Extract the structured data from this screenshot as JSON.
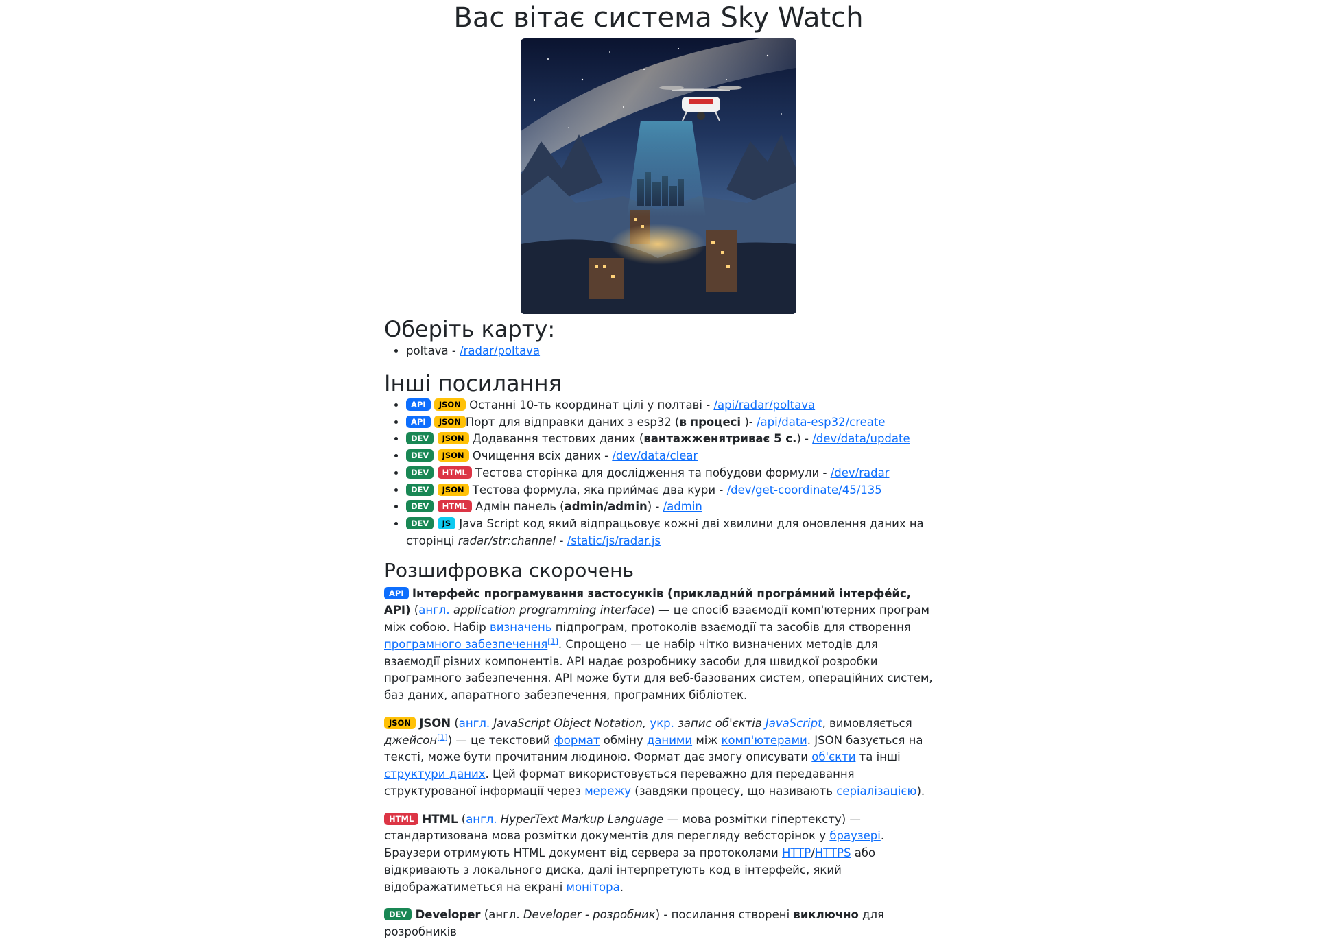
{
  "page": {
    "title": "Вас вітає система Sky Watch"
  },
  "hero": {
    "alt": "Sky Watch drone over night city"
  },
  "maps": {
    "heading": "Оберіть карту:",
    "items": [
      {
        "name": "poltava",
        "sep": " - ",
        "link": "/radar/poltava"
      }
    ]
  },
  "links": {
    "heading": "Інші посилання",
    "items": [
      {
        "text": " Останні 10-ть координат цілі у полтаві - ",
        "link": "/api/radar/poltava"
      },
      {
        "text_a": "Порт для відправки даних з esp32 (",
        "bold": "в процесі",
        "text_b": " )- ",
        "link": "/api/data-esp32/create"
      },
      {
        "text_a": " Додавання тестових даних (",
        "bold": "вантажженятриває 5 с.",
        "text_b": ") - ",
        "link": "/dev/data/update"
      },
      {
        "text": " Очищення всіх даних - ",
        "link": "/dev/data/clear"
      },
      {
        "text": " Тестова сторінка для дослідження та побудови формули - ",
        "link": "/dev/radar"
      },
      {
        "text": " Тестова формула, яка приймає два кури - ",
        "link": "/dev/get-coordinate/45/135"
      },
      {
        "text_a": " Адмін панель (",
        "bold": "admin/admin",
        "text_b": ") - ",
        "link": "/admin"
      },
      {
        "text": " Java Script код який відпрацьовує кожні дві хвилини для оновлення даних на сторінці ",
        "italic": "radar/str:channel",
        "text_b": " - ",
        "link": "/static/js/radar.js"
      }
    ]
  },
  "badges": {
    "api": "API",
    "json": "JSON",
    "dev": "DEV",
    "html": "HTML",
    "js": "JS"
  },
  "glossary": {
    "heading": "Розшифровка скорочень",
    "api": {
      "bold": "Інтерфейс програмування застосунків (прикладни́й програ́мний інтерфе́йс, API)",
      "p1": " (",
      "l_angl": "англ.",
      "i1": " application programming interface",
      "p2": ") — це спосіб взаємодії комп'ютерних програм між собою. Набір ",
      "l_vyzn": "визначень",
      "p3": " підпрограм, протоколів взаємодії та засобів для створення ",
      "l_pz": "програмного забезпечення",
      "ref": "[1]",
      "p4": ". Спрощено — це набір чітко визначених методів для взаємодії різних компонентів. API надає розробнику засоби для швидкої розробки програмного забезпечення. API може бути для веб-базованих систем, операційних систем, баз даних, апаратного забезпечення, програмних бібліотек."
    },
    "json": {
      "bold": "JSON",
      "p1": " (",
      "l_angl": "англ.",
      "i1": " JavaScript Object Notation,",
      "p2": " ",
      "l_ukr": "укр.",
      "i2": " запис об'єктів ",
      "l_js": "JavaScript",
      "p3": ", вимовляється ",
      "i3": "джейсон",
      "ref": "[1]",
      "p4": ") — це текстовий ",
      "l_format": "формат",
      "p5": " обміну ",
      "l_danymy": "даними",
      "p6": " між ",
      "l_comp": "комп'ютерами",
      "p7": ". JSON базується на тексті, може бути прочитаним людиною. Формат дає змогу описувати ",
      "l_obj": "об'єкти",
      "p8": " та інші ",
      "l_struct": "структури даних",
      "p9": ". Цей формат використовується переважно для передавання структурованої інформації через ",
      "l_net": "мережу",
      "p10": " (завдяки процесу, що називають ",
      "l_ser": "серіалізацією",
      "p11": ")."
    },
    "html": {
      "bold": "HTML",
      "p1": " (",
      "l_angl": "англ.",
      "i1": " HyperText Markup Language",
      "p2": " — мова розмітки гіпертексту) — стандартизована мова розмітки документів для перегляду вебсторінок у ",
      "l_br": "браузері",
      "p3": ". Браузери отримують HTML документ від сервера за протоколами ",
      "l_http": "HTTP",
      "slash": "/",
      "l_https": "HTTPS",
      "p4": " або відкривають з локального диска, далі інтерпретують код в інтерфейс, який відображатиметься на екрані ",
      "l_mon": "монітора",
      "p5": "."
    },
    "dev": {
      "bold": "Developer",
      "p1": " (англ. ",
      "i1": "Developer - розробник",
      "p2": ") - посилання створені ",
      "b2": "виключно",
      "p3": " для розробників"
    }
  }
}
